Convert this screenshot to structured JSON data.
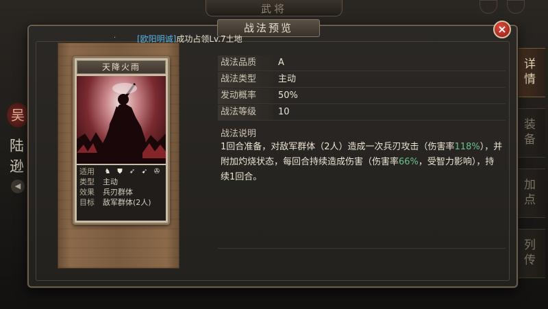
{
  "background": {
    "title": "武将",
    "hero_name": "陆逊",
    "faction": "吴"
  },
  "side_tabs": [
    {
      "label": "详情",
      "active": true
    },
    {
      "label": "装备",
      "active": false
    },
    {
      "label": "加点",
      "active": false
    },
    {
      "label": "列传",
      "active": false
    }
  ],
  "modal": {
    "title": "战法预览",
    "close_icon": "×",
    "occupy": {
      "player": "[欧阳明诚]",
      "text": "成功占领Lv.7土地"
    }
  },
  "card": {
    "name": "天降火雨",
    "applies_label": "适用",
    "applies_icons": [
      "cavalry-icon",
      "shield-icon",
      "bow-icon",
      "spear-icon",
      "chariot-icon"
    ],
    "type_label": "类型",
    "type_value": "主动",
    "effect_label": "效果",
    "effect_value": "兵刃群体",
    "target_label": "目标",
    "target_value": "敌军群体(2人)"
  },
  "stats": [
    {
      "label": "战法品质",
      "value": "A"
    },
    {
      "label": "战法类型",
      "value": "主动"
    },
    {
      "label": "发动概率",
      "value": "50%"
    },
    {
      "label": "战法等级",
      "value": "10"
    }
  ],
  "description": {
    "title": "战法说明",
    "part1": "1回合准备，对敌军群体（2人）造成一次兵刃攻击（伤害率",
    "rate1": "118%",
    "part2": "），并附加灼烧状态，每回合持续造成伤害（伤害率",
    "rate2": "66%",
    "part3": "，受智力影响），持续1回合。"
  },
  "colors": {
    "player_name": "#58b6e8",
    "rate_highlight": "#6ac28a",
    "close_button": "#c8342a"
  }
}
